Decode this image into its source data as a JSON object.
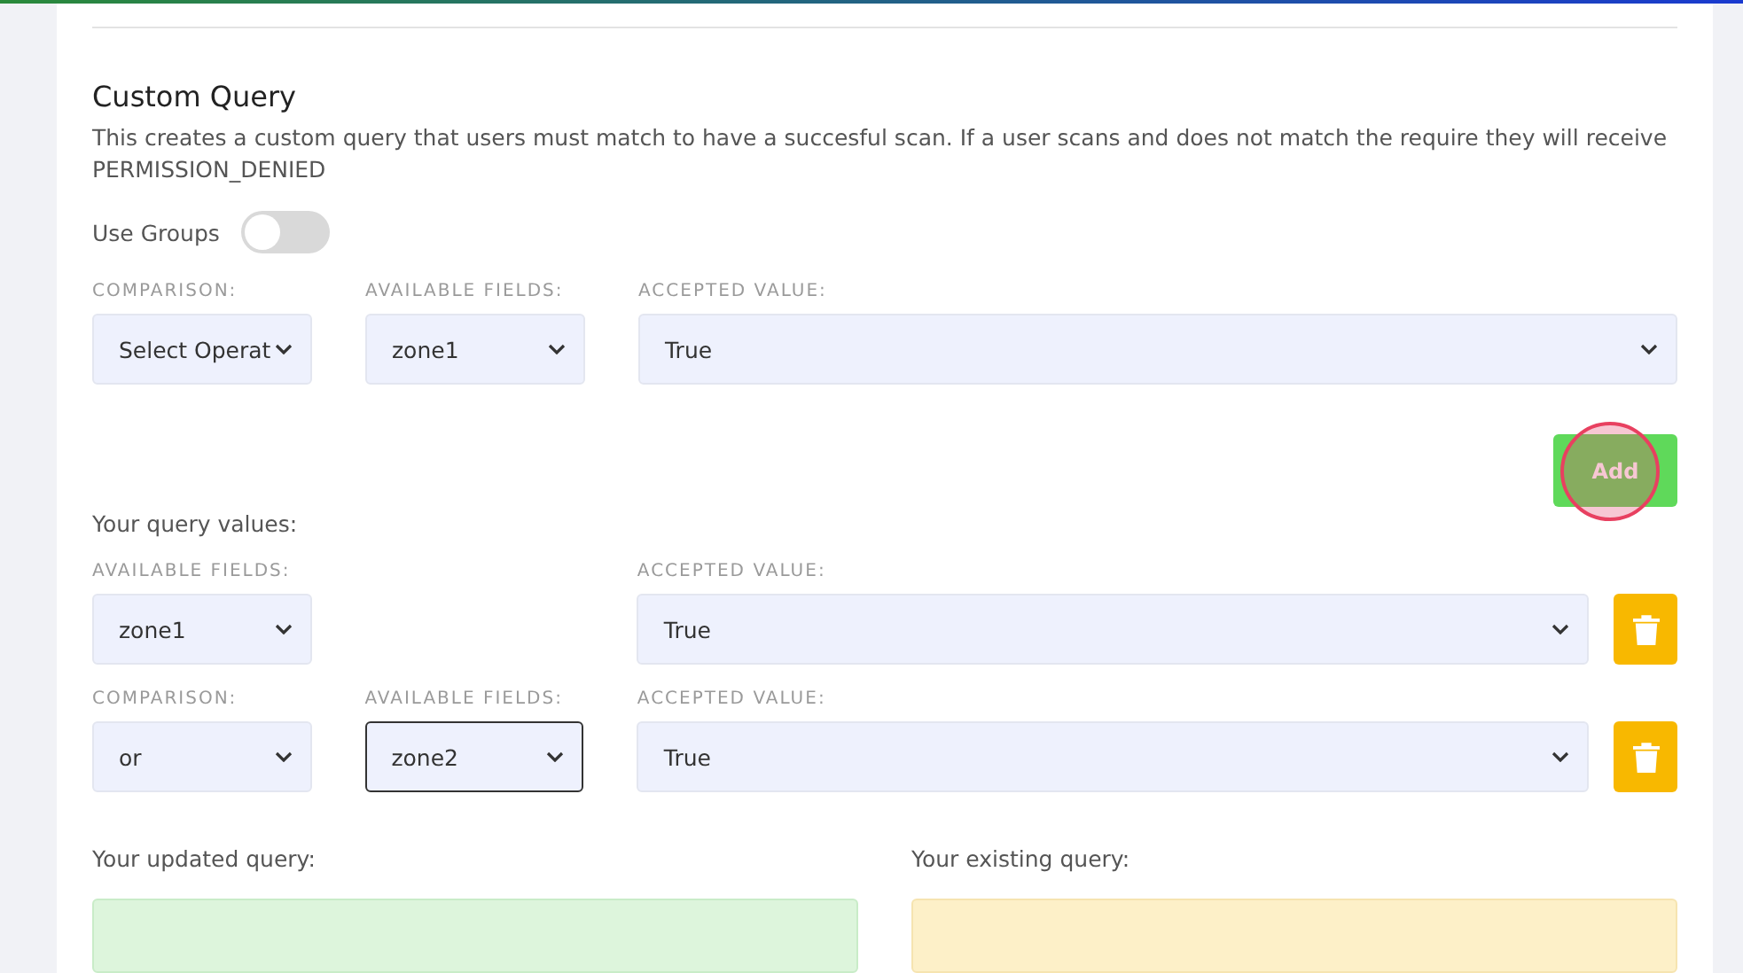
{
  "section": {
    "title": "Custom Query",
    "description": "This creates a custom query that users must match to have a succesful scan. If a user scans and does not match the require they will receive PERMISSION_DENIED"
  },
  "use_groups": {
    "label": "Use Groups",
    "on": false
  },
  "builder": {
    "fields": [
      {
        "kind": "comparison",
        "label": "COMPARISON:",
        "value": "Select Operat",
        "focused": false
      },
      {
        "kind": "field",
        "label": "AVAILABLE FIELDS:",
        "value": "zone1",
        "focused": false
      },
      {
        "kind": "value",
        "label": "ACCEPTED VALUE:",
        "value": "True",
        "focused": false
      }
    ],
    "add_button": "Add"
  },
  "query_values": {
    "title": "Your query values:",
    "rows": [
      {
        "fields": [
          {
            "kind": "field",
            "label": "AVAILABLE FIELDS:",
            "value": "zone1",
            "focused": false
          },
          {
            "kind": "spacer"
          },
          {
            "kind": "value",
            "label": "ACCEPTED VALUE:",
            "value": "True",
            "focused": false
          }
        ]
      },
      {
        "fields": [
          {
            "kind": "comparison",
            "label": "COMPARISON:",
            "value": "or",
            "focused": false
          },
          {
            "kind": "field",
            "label": "AVAILABLE FIELDS:",
            "value": "zone2",
            "focused": true
          },
          {
            "kind": "value",
            "label": "ACCEPTED VALUE:",
            "value": "True",
            "focused": false
          }
        ]
      }
    ]
  },
  "updated_query": {
    "label": "Your updated query:"
  },
  "existing_query": {
    "label": "Your existing query:"
  }
}
